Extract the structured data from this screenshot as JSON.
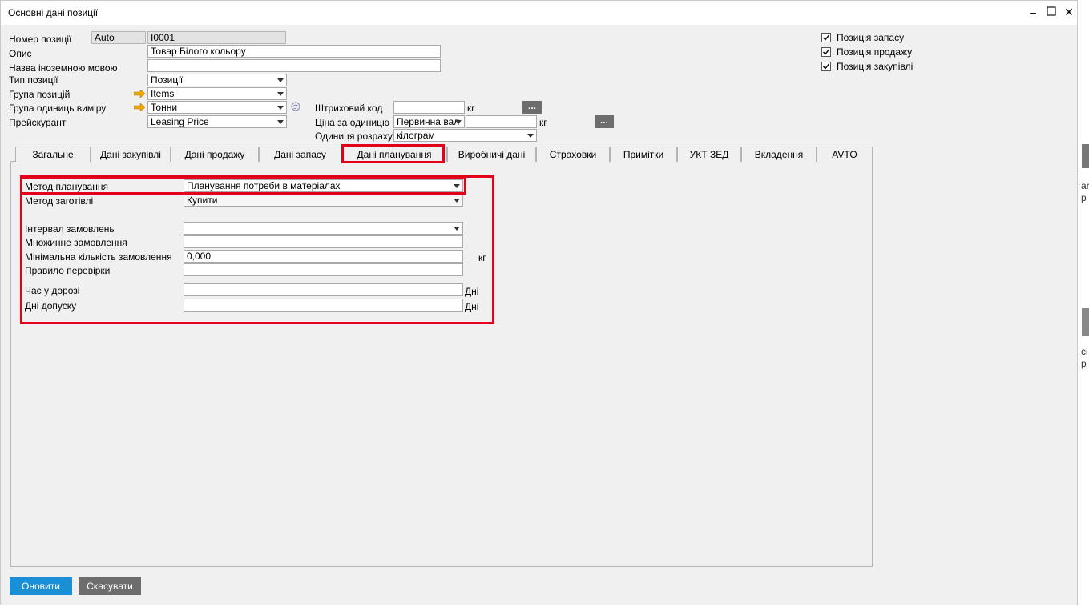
{
  "window": {
    "title": "Основні дані позиції"
  },
  "header_left": {
    "item_no_label": "Номер позиції",
    "item_no_series": "Auto",
    "item_no_value": "I0001",
    "description_label": "Опис",
    "description_value": "Товар Білого кольору",
    "foreign_name_label": "Назва іноземною мовою",
    "foreign_name_value": "",
    "item_type_label": "Тип позиції",
    "item_type_value": "Позиції",
    "item_group_label": "Група позицій",
    "item_group_value": "Items",
    "uom_group_label": "Група одиниць виміру",
    "uom_group_value": "Тонни",
    "price_list_label": "Прейскурант",
    "price_list_value": "Leasing Price"
  },
  "header_middle": {
    "barcode_label": "Штриховий код",
    "barcode_value": "",
    "barcode_unit": "кг",
    "unit_price_label": "Ціна за одиницю",
    "unit_price_currency": "Первинна вал",
    "unit_price_value": "",
    "unit_price_unit": "кг",
    "pricing_unit_label": "Одиниця розраху",
    "pricing_unit_value": "кілограм"
  },
  "checkboxes": [
    {
      "label": "Позиція запасу",
      "checked": true
    },
    {
      "label": "Позиція продажу",
      "checked": true
    },
    {
      "label": "Позиція закупівлі",
      "checked": true
    }
  ],
  "tabs": [
    {
      "label": "Загальне"
    },
    {
      "label": "Дані закупівлі"
    },
    {
      "label": "Дані продажу"
    },
    {
      "label": "Дані запасу"
    },
    {
      "label": "Дані планування"
    },
    {
      "label": "Виробничі дані"
    },
    {
      "label": "Страховки"
    },
    {
      "label": "Примітки"
    },
    {
      "label": "УКТ ЗЕД"
    },
    {
      "label": "Вкладення"
    },
    {
      "label": "AVTO"
    }
  ],
  "active_tab_index": 4,
  "planning": {
    "method_label": "Метод планування",
    "method_value": "Планування потреби в матеріалах",
    "procurement_label": "Метод заготівлі",
    "procurement_value": "Купити",
    "order_interval_label": "Інтервал замовлень",
    "order_interval_value": "",
    "order_multiple_label": "Множинне замовлення",
    "order_multiple_value": "",
    "min_order_qty_label": "Мінімальна кількість замовлення",
    "min_order_qty_value": "0,000",
    "min_order_qty_unit": "кг",
    "check_rule_label": "Правило перевірки",
    "check_rule_value": "",
    "lead_time_label": "Час у дорозі",
    "lead_time_value": "",
    "lead_time_unit": "Дні",
    "tolerance_days_label": "Дні допуску",
    "tolerance_days_value": "",
    "tolerance_days_unit": "Дні"
  },
  "buttons": {
    "update": "Оновити",
    "cancel": "Скасувати",
    "more": "..."
  },
  "background_fragments": {
    "frag1": "ar",
    "frag2": "p",
    "frag3": "ci",
    "frag4": "p"
  },
  "colors": {
    "highlight": "#e3001b",
    "primary_button": "#1a8fd6",
    "secondary_button": "#6d6d6d",
    "link_arrow": "#f0a800"
  }
}
